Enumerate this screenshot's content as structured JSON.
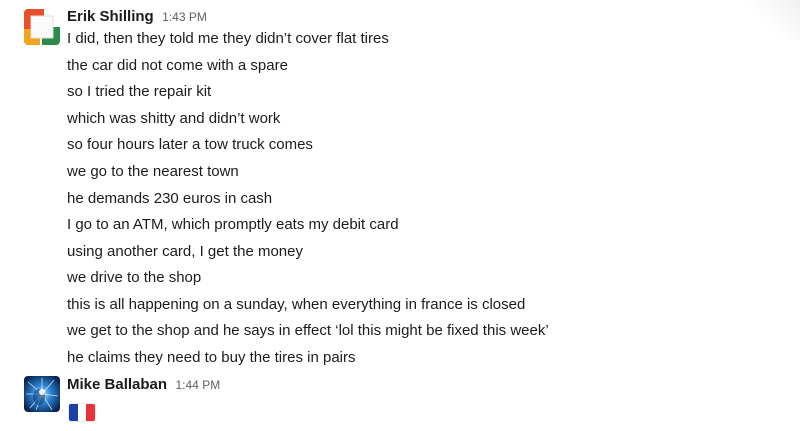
{
  "messages": [
    {
      "author": "Erik Shilling",
      "time": "1:43 PM",
      "lines": [
        "I did, then they told me they didn’t cover flat tires",
        "the car did not come with a spare",
        "so I tried the repair kit",
        "which was shitty and didn’t work",
        "so four hours later a tow truck comes",
        "we go to the nearest town",
        "he demands 230 euros in cash",
        "I go to an ATM, which promptly eats my debit card",
        "using another card, I get the money",
        "we drive to the shop",
        "this is all happening on a sunday, when everything in france is closed",
        "we get to the shop and he says in effect ‘lol this might be fixed this week’",
        "he claims they need to buy the tires in pairs"
      ]
    },
    {
      "author": "Mike Ballaban",
      "time": "1:44 PM",
      "emoji": "flag-fr-icon"
    }
  ],
  "colors": {
    "author": "#1d1c1d",
    "timestamp": "#616061",
    "text": "#1d1c1d",
    "flag_blue": "#1f3fa8",
    "flag_white": "#ffffff",
    "flag_red": "#e8323c"
  }
}
